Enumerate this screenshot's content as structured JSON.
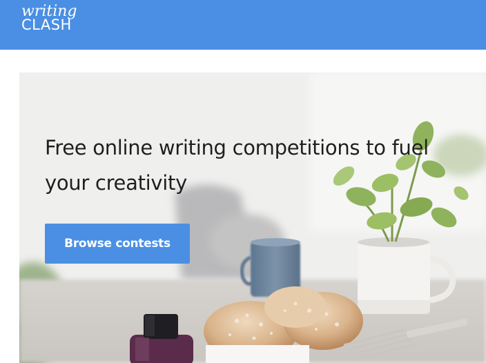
{
  "header": {
    "logo_top": "writing",
    "logo_bottom": "CLASH",
    "background_color": "#4a8fe3"
  },
  "hero": {
    "headline": "Free online writing competitions to fuel your creativity",
    "cta_label": "Browse contests",
    "cta_color": "#4a8fe3"
  }
}
